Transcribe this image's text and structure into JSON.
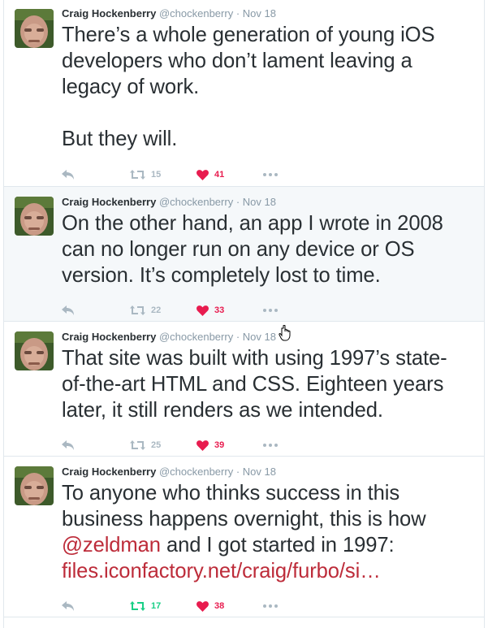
{
  "tweets": [
    {
      "fullname": "Craig Hockenberry",
      "username": "@chockenberry",
      "separator": "·",
      "time": "Nov 18",
      "text_parts": [
        "There’s a whole generation of young iOS developers who don’t lament leaving a legacy of work.",
        "But they will."
      ],
      "retweets": "15",
      "likes": "41",
      "retweet_active": false,
      "hovered": false
    },
    {
      "fullname": "Craig Hockenberry",
      "username": "@chockenberry",
      "separator": "·",
      "time": "Nov 18",
      "text_parts": [
        "On the other hand, an app I wrote in 2008 can no longer run on any device or OS version. It’s completely lost to time."
      ],
      "retweets": "22",
      "likes": "33",
      "retweet_active": false,
      "hovered": true
    },
    {
      "fullname": "Craig Hockenberry",
      "username": "@chockenberry",
      "separator": "·",
      "time": "Nov 18",
      "text_parts": [
        "That site was built with using 1997’s state-of-the-art HTML and CSS. Eighteen years later, it still renders as we intended."
      ],
      "retweets": "25",
      "likes": "39",
      "retweet_active": false,
      "hovered": false
    },
    {
      "fullname": "Craig Hockenberry",
      "username": "@chockenberry",
      "separator": "·",
      "time": "Nov 18",
      "text_before": "To anyone who thinks success in this business happens overnight, this is how",
      "mention": "@zeldman",
      "text_after": "and I got started in 1997:",
      "url": "files.iconfactory.net/craig/furbo/si…",
      "retweets": "17",
      "likes": "38",
      "retweet_active": true,
      "hovered": false
    }
  ],
  "icons": {
    "reply": "reply-icon",
    "retweet": "retweet-icon",
    "like": "heart-icon",
    "more": "more-dots-icon",
    "cursor": "hand-pointer-icon"
  },
  "colors": {
    "text": "#292f33",
    "secondary": "#8899a6",
    "link": "#bd2c3a",
    "like": "#e81c4f",
    "retweet_active": "#19cf86",
    "hover_bg": "#f5f8fa"
  }
}
